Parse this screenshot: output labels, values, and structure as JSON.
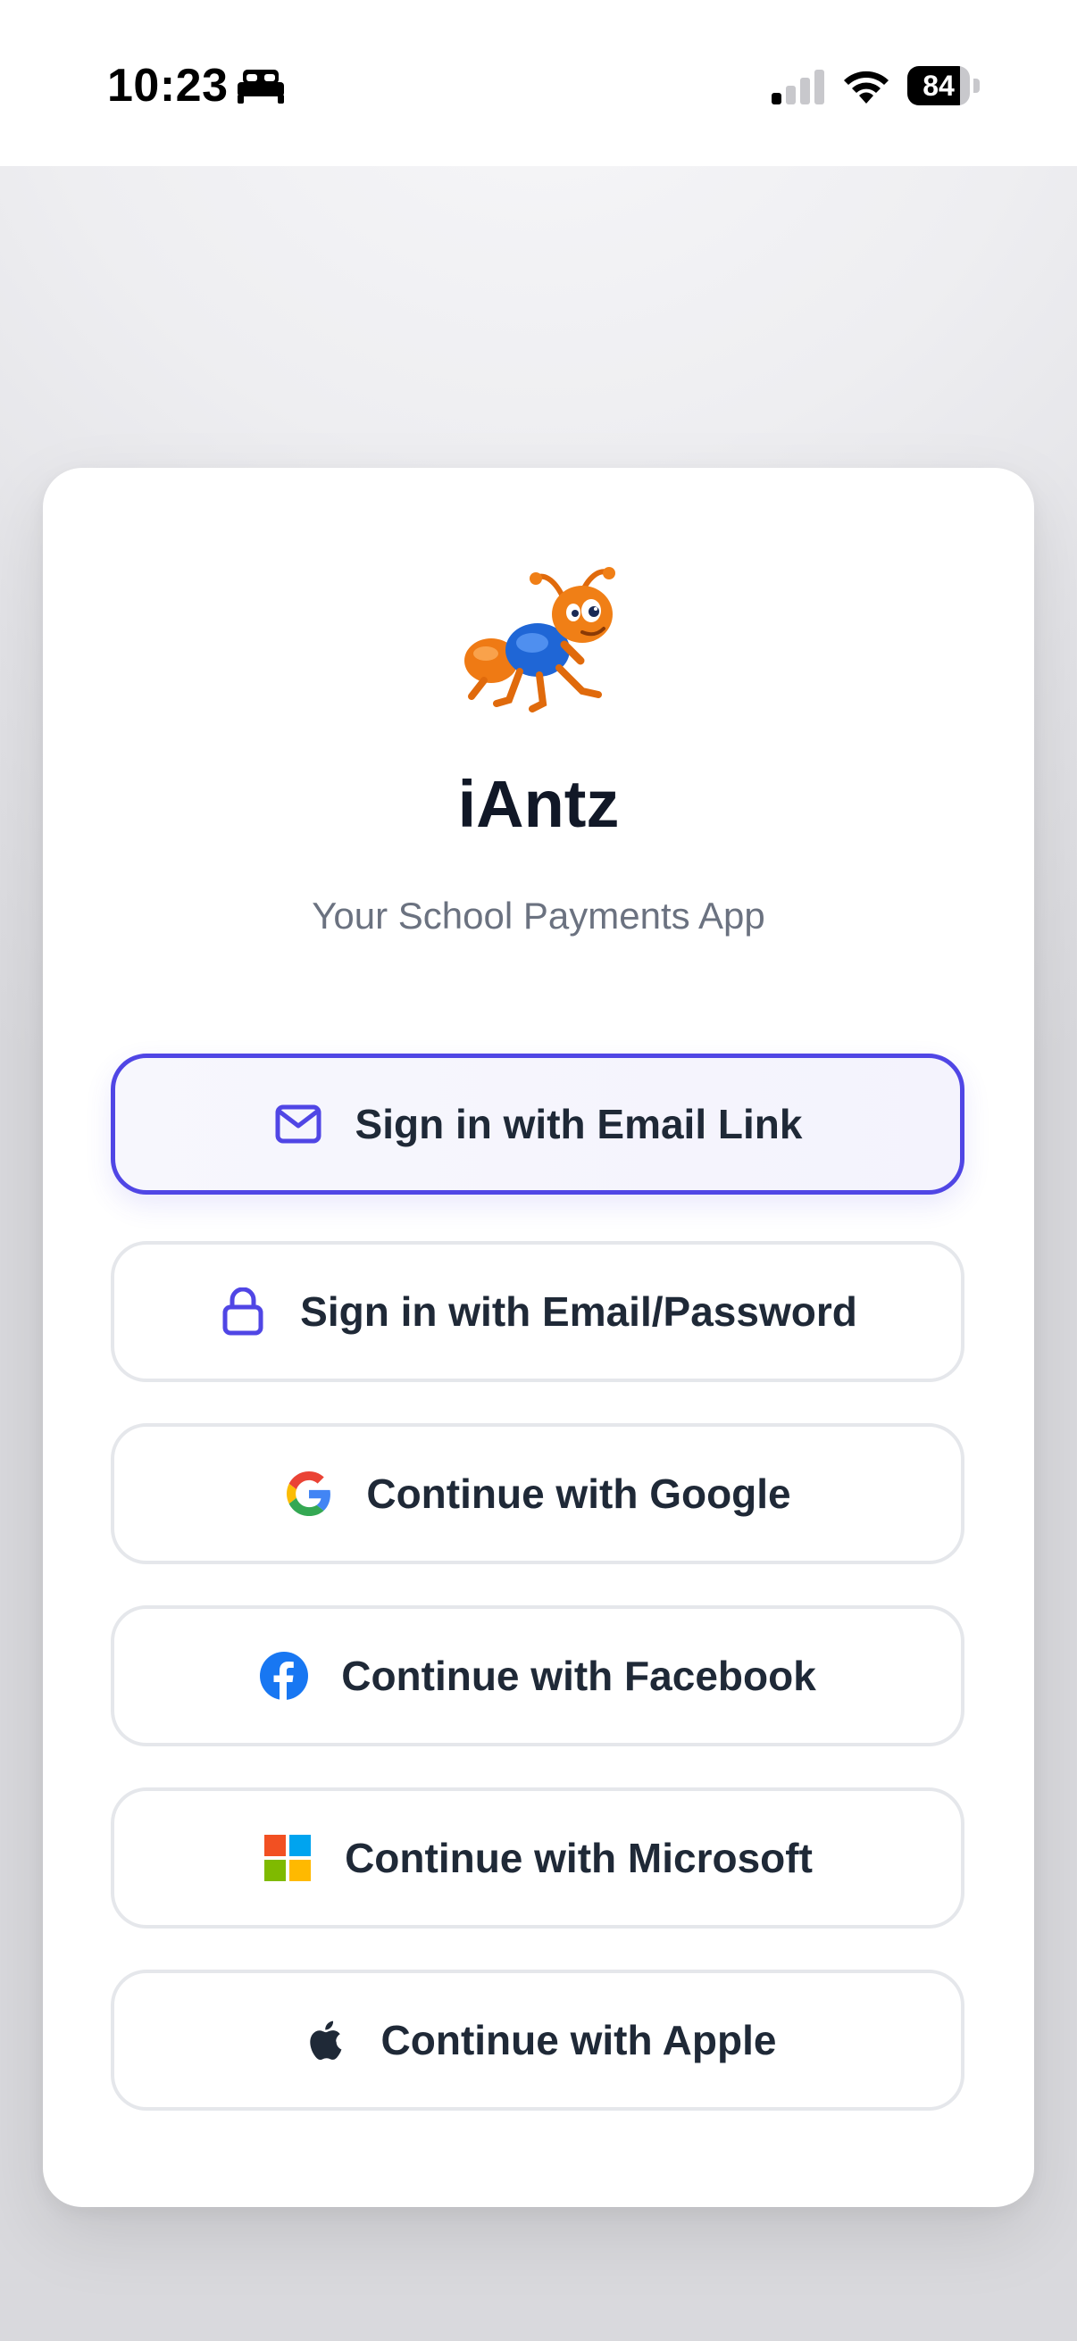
{
  "status_bar": {
    "time": "10:23",
    "battery": "84",
    "icons": [
      "sleep-focus-icon",
      "cellular-signal-icon",
      "wifi-icon",
      "battery-icon"
    ]
  },
  "app": {
    "title": "iAntz",
    "subtitle": "Your School Payments App",
    "logo": "ant-mascot-logo"
  },
  "sign_in_options": [
    {
      "label": "Sign in with Email Link",
      "icon": "mail-icon",
      "primary": true
    },
    {
      "label": "Sign in with Email/Password",
      "icon": "lock-icon"
    },
    {
      "label": "Continue with Google",
      "icon": "google-icon"
    },
    {
      "label": "Continue with Facebook",
      "icon": "facebook-icon"
    },
    {
      "label": "Continue with Microsoft",
      "icon": "microsoft-icon"
    },
    {
      "label": "Continue with Apple",
      "icon": "apple-icon"
    }
  ],
  "colors": {
    "accent": "#5046e5",
    "title": "#111827",
    "subtitle": "#6b7280",
    "facebook": "#1877f2",
    "microsoft_red": "#f25022",
    "microsoft_green": "#7fba00",
    "microsoft_blue": "#00a4ef",
    "microsoft_yellow": "#ffb900"
  }
}
